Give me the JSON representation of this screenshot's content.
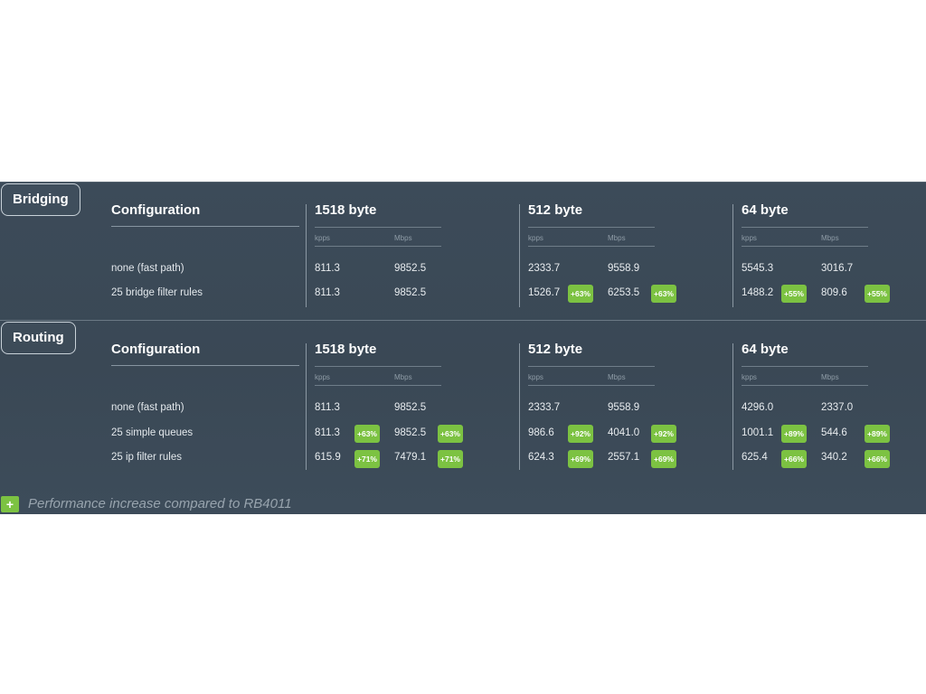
{
  "sub_labels": {
    "kpps": "kpps",
    "mbps": "Mbps"
  },
  "bridging": {
    "label": "Bridging",
    "config_header": "Configuration",
    "rows": [
      {
        "label": "none (fast path)",
        "v1518": [
          "811.3",
          "9852.5"
        ],
        "v512": [
          "2333.7",
          "9558.9"
        ],
        "v64": [
          "5545.3",
          "3016.7"
        ]
      },
      {
        "label": "25 bridge filter rules",
        "v1518": [
          "811.3",
          "9852.5"
        ],
        "v512": [
          "1526.7",
          "6253.5"
        ],
        "v512_badges": [
          "+63%",
          "+63%"
        ],
        "v64": [
          "1488.2",
          "809.6"
        ],
        "v64_badges": [
          "+55%",
          "+55%"
        ]
      }
    ],
    "columns": [
      "1518 byte",
      "512 byte",
      "64 byte"
    ]
  },
  "routing": {
    "label": "Routing",
    "config_header": "Configuration",
    "rows": [
      {
        "label": "none (fast path)",
        "v1518": [
          "811.3",
          "9852.5"
        ],
        "v512": [
          "2333.7",
          "9558.9"
        ],
        "v64": [
          "4296.0",
          "2337.0"
        ]
      },
      {
        "label": "25 simple queues",
        "v1518": [
          "811.3",
          "9852.5"
        ],
        "v1518_badges": [
          "+63%",
          "+63%"
        ],
        "v512": [
          "986.6",
          "4041.0"
        ],
        "v512_badges": [
          "+92%",
          "+92%"
        ],
        "v64": [
          "1001.1",
          "544.6"
        ],
        "v64_badges": [
          "+89%",
          "+89%"
        ]
      },
      {
        "label": "25 ip filter rules",
        "v1518": [
          "615.9",
          "7479.1"
        ],
        "v1518_badges": [
          "+71%",
          "+71%"
        ],
        "v512": [
          "624.3",
          "2557.1"
        ],
        "v512_badges": [
          "+69%",
          "+69%"
        ],
        "v64": [
          "625.4",
          "340.2"
        ],
        "v64_badges": [
          "+66%",
          "+66%"
        ]
      }
    ],
    "columns": [
      "1518 byte",
      "512 byte",
      "64 byte"
    ]
  },
  "legend": {
    "symbol": "+",
    "text": "Performance increase compared to RB4011",
    "badge_color": "#7cc242"
  },
  "colors": {
    "panel_bg": "#3c4b59",
    "accent_green": "#7cc242"
  }
}
